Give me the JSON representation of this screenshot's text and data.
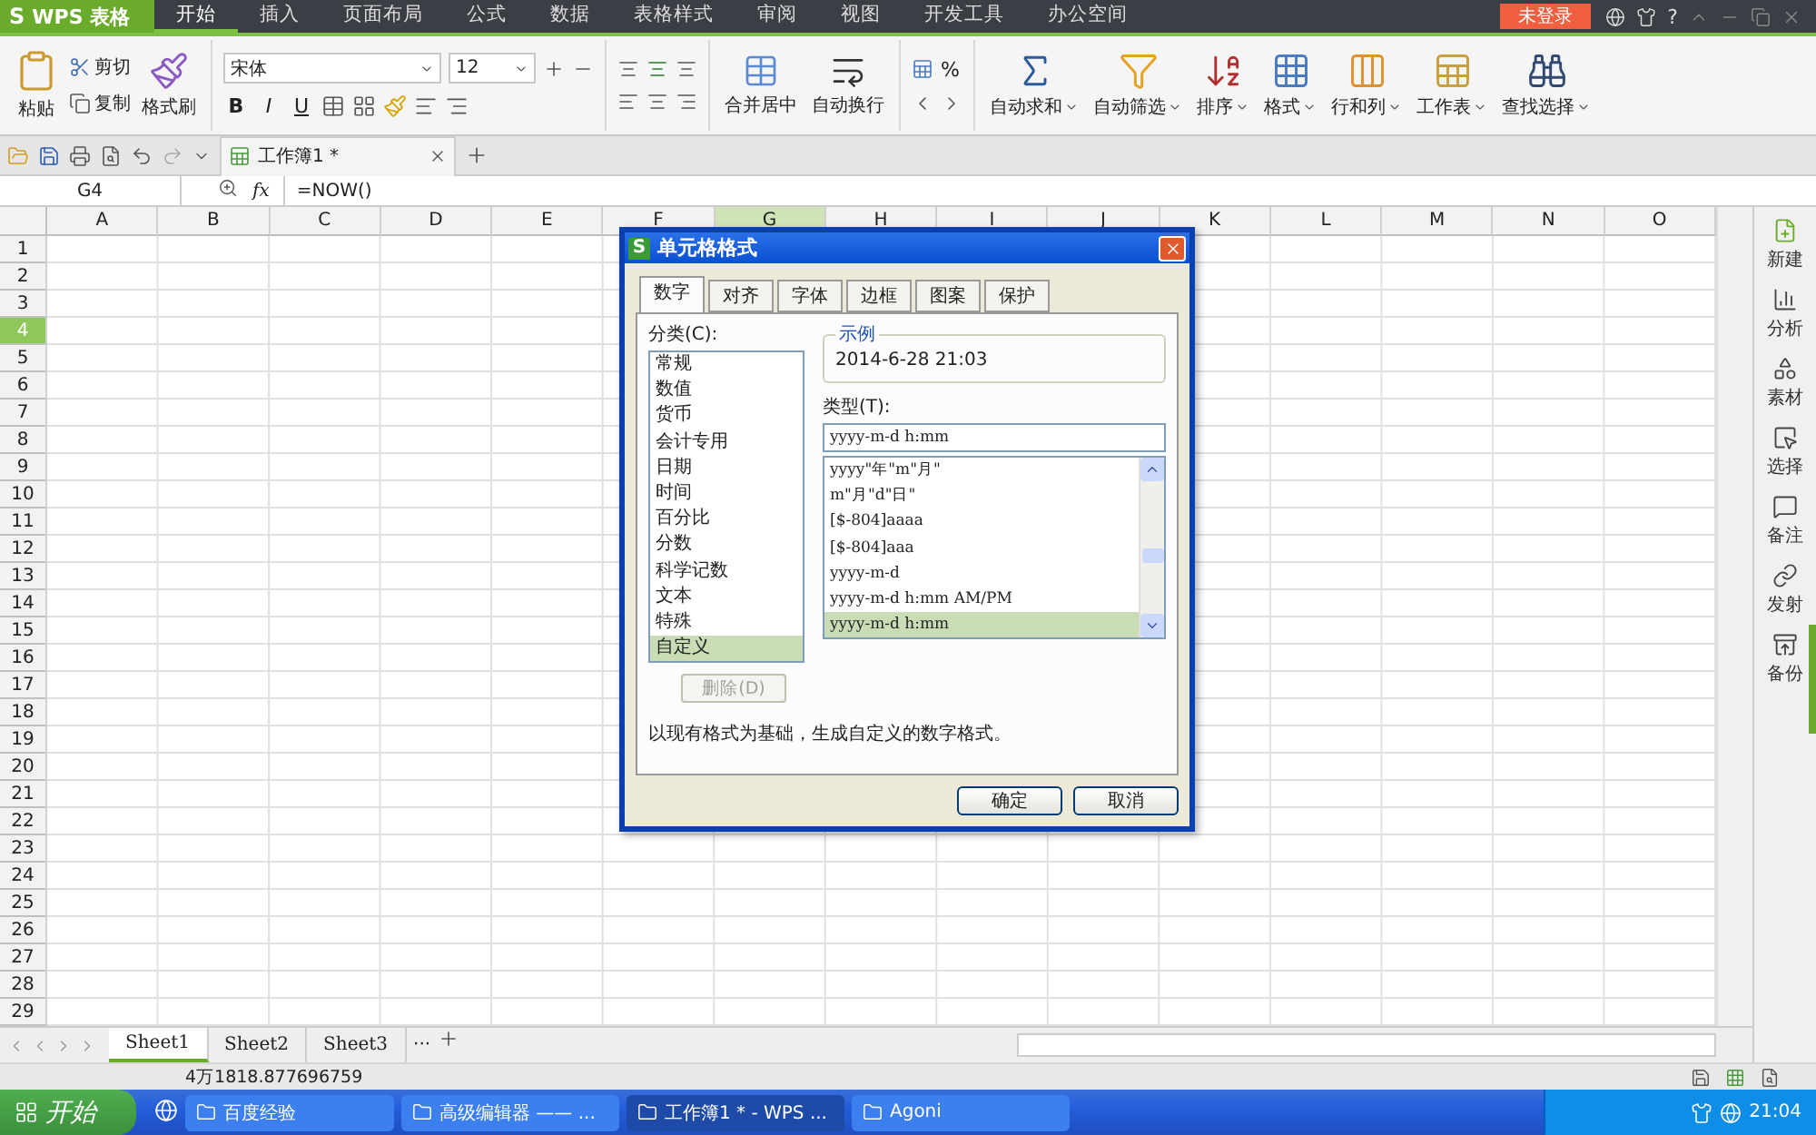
{
  "app_menu": {
    "logo": "S",
    "title": "WPS 表格"
  },
  "menu_tabs": [
    {
      "label": "开始",
      "selected": true
    },
    {
      "label": "插入",
      "selected": false
    },
    {
      "label": "页面布局",
      "selected": false
    },
    {
      "label": "公式",
      "selected": false
    },
    {
      "label": "数据",
      "selected": false
    },
    {
      "label": "表格样式",
      "selected": false
    },
    {
      "label": "审阅",
      "selected": false
    },
    {
      "label": "视图",
      "selected": false
    },
    {
      "label": "开发工具",
      "selected": false
    },
    {
      "label": "办公空间",
      "selected": false
    }
  ],
  "login_badge": "未登录",
  "help": "?",
  "ribbon": {
    "paste": "粘贴",
    "cut": "剪切",
    "copy": "复制",
    "format_painter": "格式刷",
    "font_name": "宋体",
    "font_size": "12",
    "bold": "B",
    "italic": "I",
    "underline": "U",
    "merge": "合并居中",
    "wrap": "自动换行",
    "percent": "%",
    "commands": [
      "自动求和",
      "自动筛选",
      "排序",
      "格式",
      "行和列",
      "工作表",
      "查找选择"
    ]
  },
  "doc_tab": {
    "title": "工作簿1 *"
  },
  "name_box": "G4",
  "fx": "fx",
  "formula": "=NOW()",
  "columns": [
    {
      "label": "A",
      "selected": false
    },
    {
      "label": "B",
      "selected": false
    },
    {
      "label": "C",
      "selected": false
    },
    {
      "label": "D",
      "selected": false
    },
    {
      "label": "E",
      "selected": false
    },
    {
      "label": "F",
      "selected": false
    },
    {
      "label": "G",
      "selected": true
    },
    {
      "label": "H",
      "selected": false
    },
    {
      "label": "I",
      "selected": false
    },
    {
      "label": "J",
      "selected": false
    },
    {
      "label": "K",
      "selected": false
    },
    {
      "label": "L",
      "selected": false
    },
    {
      "label": "M",
      "selected": false
    },
    {
      "label": "N",
      "selected": false
    },
    {
      "label": "O",
      "selected": false
    }
  ],
  "rows": [
    {
      "label": "1",
      "selected": false
    },
    {
      "label": "2",
      "selected": false
    },
    {
      "label": "3",
      "selected": false
    },
    {
      "label": "4",
      "selected": true
    },
    {
      "label": "5",
      "selected": false
    },
    {
      "label": "6",
      "selected": false
    },
    {
      "label": "7",
      "selected": false
    },
    {
      "label": "8",
      "selected": false
    },
    {
      "label": "9",
      "selected": false
    },
    {
      "label": "10",
      "selected": false
    },
    {
      "label": "11",
      "selected": false
    },
    {
      "label": "12",
      "selected": false
    },
    {
      "label": "13",
      "selected": false
    },
    {
      "label": "14",
      "selected": false
    },
    {
      "label": "15",
      "selected": false
    },
    {
      "label": "16",
      "selected": false
    },
    {
      "label": "17",
      "selected": false
    },
    {
      "label": "18",
      "selected": false
    },
    {
      "label": "19",
      "selected": false
    },
    {
      "label": "20",
      "selected": false
    },
    {
      "label": "21",
      "selected": false
    },
    {
      "label": "22",
      "selected": false
    },
    {
      "label": "23",
      "selected": false
    },
    {
      "label": "24",
      "selected": false
    },
    {
      "label": "25",
      "selected": false
    },
    {
      "label": "26",
      "selected": false
    },
    {
      "label": "27",
      "selected": false
    },
    {
      "label": "28",
      "selected": false
    },
    {
      "label": "29",
      "selected": false
    }
  ],
  "sheet_tabs": [
    {
      "label": "Sheet1",
      "selected": true
    },
    {
      "label": "Sheet2",
      "selected": false
    },
    {
      "label": "Sheet3",
      "selected": false
    }
  ],
  "sheet_more": "···",
  "status_value": "4万1818.877696759",
  "sidebar": [
    "新建",
    "分析",
    "素材",
    "选择",
    "备注",
    "发射",
    "备份"
  ],
  "dialog": {
    "logo": "S",
    "title": "单元格格式",
    "tabs": [
      {
        "label": "数字",
        "selected": true
      },
      {
        "label": "对齐",
        "selected": false
      },
      {
        "label": "字体",
        "selected": false
      },
      {
        "label": "边框",
        "selected": false
      },
      {
        "label": "图案",
        "selected": false
      },
      {
        "label": "保护",
        "selected": false
      }
    ],
    "category_label": "分类(C):",
    "categories": [
      {
        "label": "常规",
        "selected": false
      },
      {
        "label": "数值",
        "selected": false
      },
      {
        "label": "货币",
        "selected": false
      },
      {
        "label": "会计专用",
        "selected": false
      },
      {
        "label": "日期",
        "selected": false
      },
      {
        "label": "时间",
        "selected": false
      },
      {
        "label": "百分比",
        "selected": false
      },
      {
        "label": "分数",
        "selected": false
      },
      {
        "label": "科学记数",
        "selected": false
      },
      {
        "label": "文本",
        "selected": false
      },
      {
        "label": "特殊",
        "selected": false
      },
      {
        "label": "自定义",
        "selected": true
      }
    ],
    "sample_label": "示例",
    "sample": "2014-6-28 21:03",
    "type_label": "类型(T):",
    "type_value": "yyyy-m-d h:mm",
    "formats": [
      {
        "label": "yyyy\"年\"m\"月\"",
        "selected": false
      },
      {
        "label": "m\"月\"d\"日\"",
        "selected": false
      },
      {
        "label": "[$-804]aaaa",
        "selected": false
      },
      {
        "label": "[$-804]aaa",
        "selected": false
      },
      {
        "label": "yyyy-m-d",
        "selected": false
      },
      {
        "label": "yyyy-m-d h:mm AM/PM",
        "selected": false
      },
      {
        "label": "yyyy-m-d h:mm",
        "selected": true
      }
    ],
    "delete_button": {
      "label": "删除(D)",
      "disabled": true
    },
    "description": "以现有格式为基础，生成自定义的数字格式。",
    "buttons": [
      "确定",
      "取消"
    ]
  },
  "taskbar": {
    "start": "开始",
    "items": [
      {
        "label": "百度经验",
        "selected": false
      },
      {
        "label": "高级编辑器 —— ...",
        "selected": false
      },
      {
        "label": "工作簿1 * - WPS ...",
        "selected": true
      },
      {
        "label": "Agoni",
        "selected": false
      }
    ],
    "clock": "21:04"
  }
}
